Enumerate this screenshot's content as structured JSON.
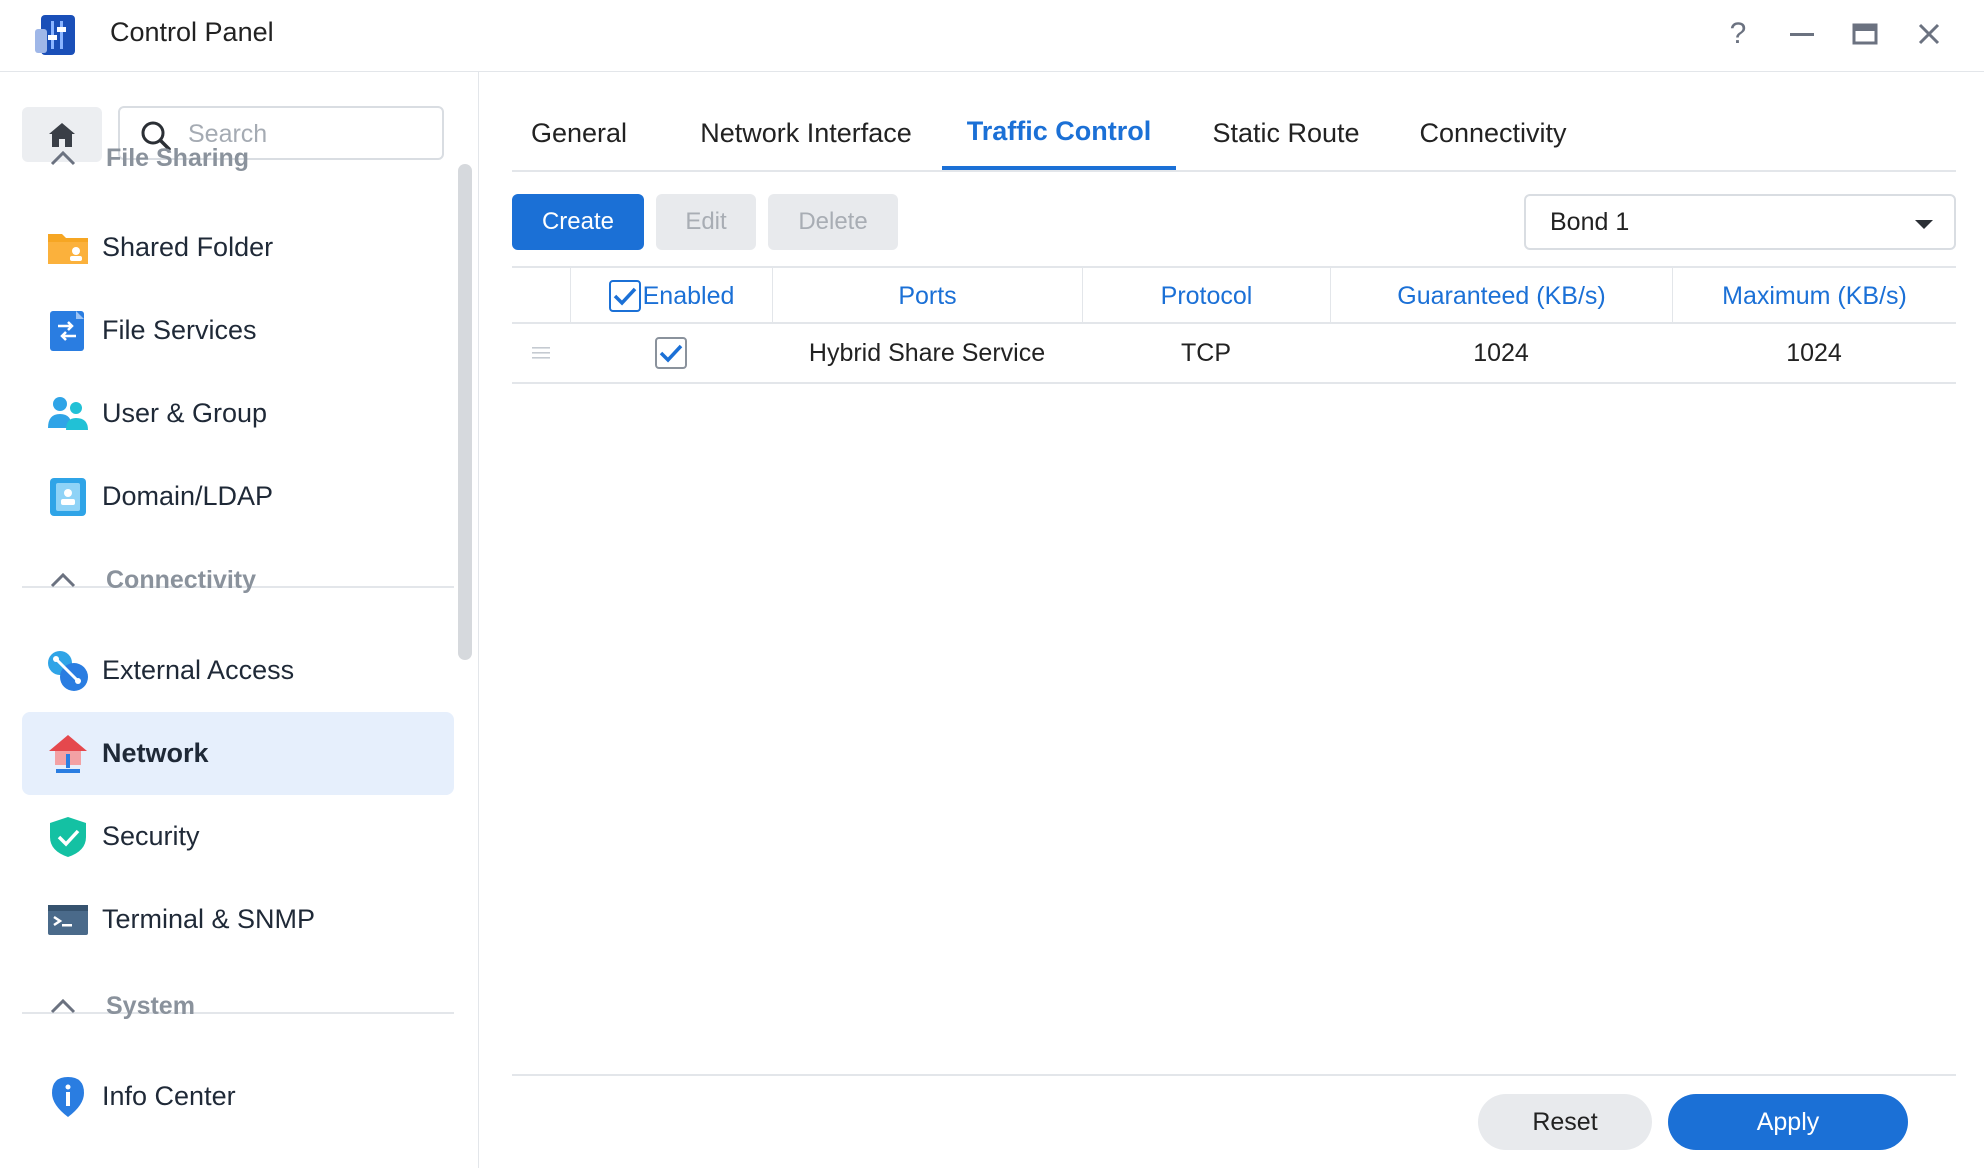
{
  "window": {
    "title": "Control Panel",
    "controls": [
      "help-icon",
      "minimize-icon",
      "maximize-icon",
      "close-icon"
    ],
    "help_glyph": "?"
  },
  "sidebar": {
    "search_placeholder": "Search",
    "groups": [
      {
        "label": "File Sharing",
        "items": [
          {
            "label": "Shared Folder",
            "icon": "folder-icon"
          },
          {
            "label": "File Services",
            "icon": "file-services-icon"
          },
          {
            "label": "User & Group",
            "icon": "users-icon"
          },
          {
            "label": "Domain/LDAP",
            "icon": "domain-icon"
          }
        ]
      },
      {
        "label": "Connectivity",
        "items": [
          {
            "label": "External Access",
            "icon": "external-access-icon"
          },
          {
            "label": "Network",
            "icon": "network-icon",
            "active": true
          },
          {
            "label": "Security",
            "icon": "shield-icon"
          },
          {
            "label": "Terminal & SNMP",
            "icon": "terminal-icon"
          }
        ]
      },
      {
        "label": "System",
        "items": [
          {
            "label": "Info Center",
            "icon": "info-icon"
          }
        ]
      }
    ]
  },
  "tabs": [
    {
      "label": "General"
    },
    {
      "label": "Network Interface"
    },
    {
      "label": "Traffic Control",
      "active": true
    },
    {
      "label": "Static Route"
    },
    {
      "label": "Connectivity"
    }
  ],
  "toolbar": {
    "create": "Create",
    "edit": "Edit",
    "delete": "Delete",
    "interface_select": "Bond 1"
  },
  "table": {
    "columns": [
      "Enabled",
      "Ports",
      "Protocol",
      "Guaranteed (KB/s)",
      "Maximum (KB/s)"
    ],
    "header_checked": true,
    "rows": [
      {
        "enabled": true,
        "ports": "Hybrid Share Service",
        "protocol": "TCP",
        "guaranteed": "1024",
        "maximum": "1024"
      }
    ]
  },
  "footer": {
    "reset": "Reset",
    "apply": "Apply"
  },
  "colors": {
    "accent": "#1b70d6",
    "active_nav_bg": "#e6effc",
    "group_label": "#8a929c"
  }
}
